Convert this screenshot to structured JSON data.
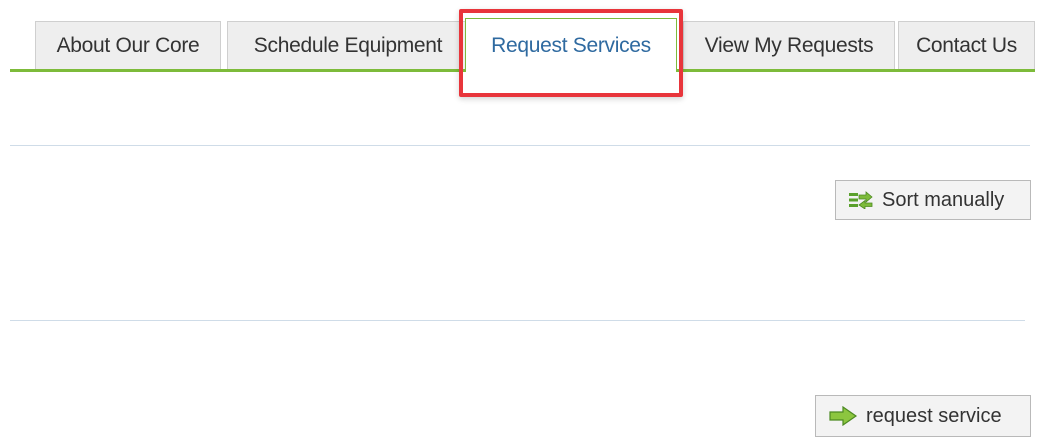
{
  "tabs": [
    {
      "label": "About Our Core",
      "active": false
    },
    {
      "label": "Schedule Equipment",
      "active": false
    },
    {
      "label": "Request Services",
      "active": true
    },
    {
      "label": "View My Requests",
      "active": false
    },
    {
      "label": "Contact Us",
      "active": false
    }
  ],
  "toolbar": {
    "sort_label": "Sort manually",
    "sort_icon": "sort-arrows-icon"
  },
  "actions": {
    "request_label": "request service",
    "request_icon": "arrow-right-icon"
  },
  "colors": {
    "accent_green": "#7dbb3a",
    "active_tab_text": "#2f6aa0",
    "highlight_red": "#e8353b",
    "divider": "#cfdce8"
  }
}
